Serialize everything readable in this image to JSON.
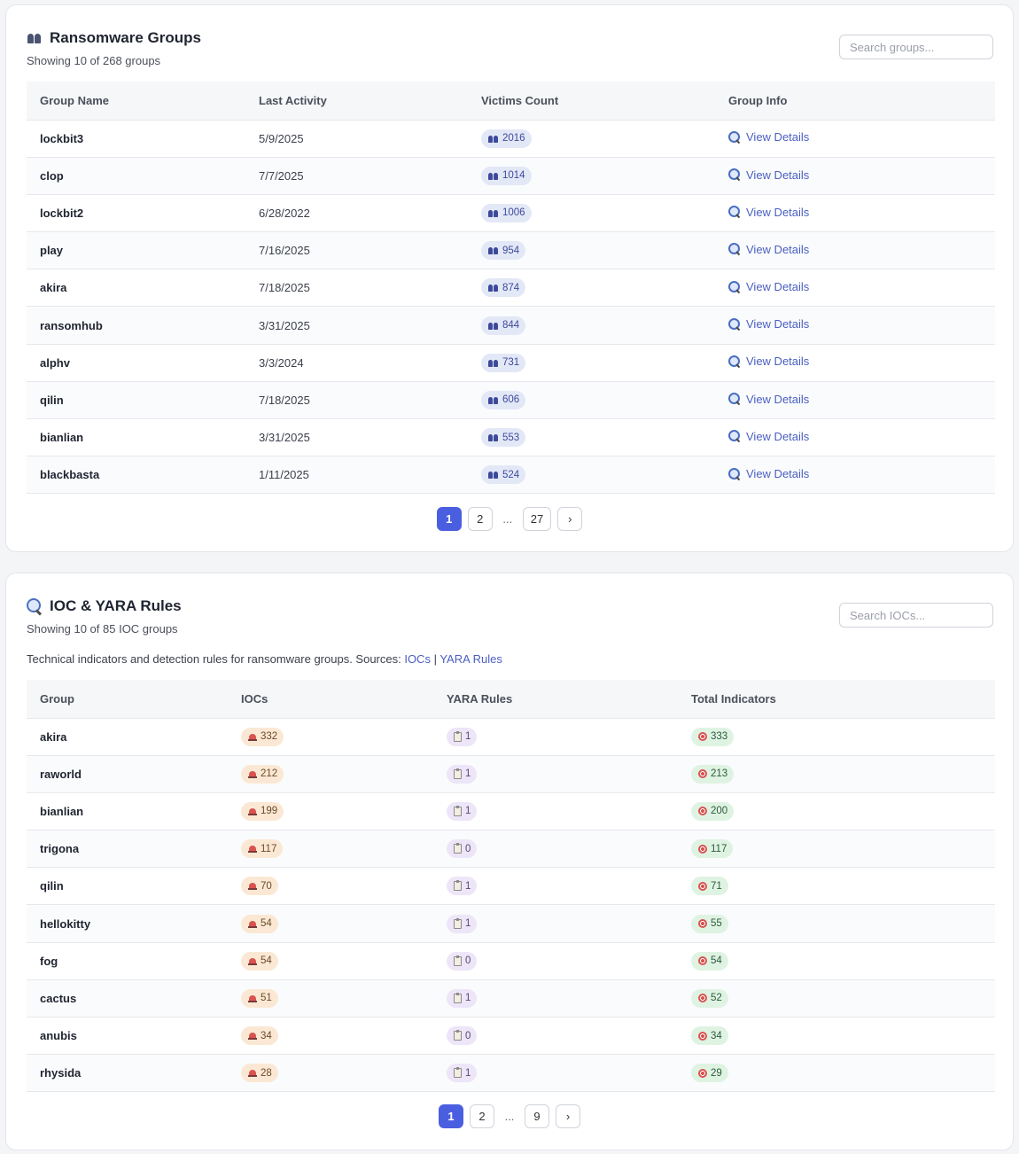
{
  "groups_panel": {
    "title": "Ransomware Groups",
    "subtitle": "Showing 10 of 268 groups",
    "search_placeholder": "Search groups...",
    "columns": [
      "Group Name",
      "Last Activity",
      "Victims Count",
      "Group Info"
    ],
    "link_label": "View Details",
    "rows": [
      {
        "name": "lockbit3",
        "last_activity": "5/9/2025",
        "victims": "2016"
      },
      {
        "name": "clop",
        "last_activity": "7/7/2025",
        "victims": "1014"
      },
      {
        "name": "lockbit2",
        "last_activity": "6/28/2022",
        "victims": "1006"
      },
      {
        "name": "play",
        "last_activity": "7/16/2025",
        "victims": "954"
      },
      {
        "name": "akira",
        "last_activity": "7/18/2025",
        "victims": "874"
      },
      {
        "name": "ransomhub",
        "last_activity": "3/31/2025",
        "victims": "844"
      },
      {
        "name": "alphv",
        "last_activity": "3/3/2024",
        "victims": "731"
      },
      {
        "name": "qilin",
        "last_activity": "7/18/2025",
        "victims": "606"
      },
      {
        "name": "bianlian",
        "last_activity": "3/31/2025",
        "victims": "553"
      },
      {
        "name": "blackbasta",
        "last_activity": "1/11/2025",
        "victims": "524"
      }
    ],
    "pagination": [
      "1",
      "2",
      "...",
      "27",
      "›"
    ]
  },
  "ioc_panel": {
    "title": "IOC & YARA Rules",
    "subtitle": "Showing 10 of 85 IOC groups",
    "search_placeholder": "Search IOCs...",
    "description": "Technical indicators and detection rules for ransomware groups. Sources: ",
    "source_link_1": "IOCs",
    "source_sep": " | ",
    "source_link_2": "YARA Rules",
    "columns": [
      "Group",
      "IOCs",
      "YARA Rules",
      "Total Indicators"
    ],
    "rows": [
      {
        "name": "akira",
        "iocs": "332",
        "yara": "1",
        "total": "333"
      },
      {
        "name": "raworld",
        "iocs": "212",
        "yara": "1",
        "total": "213"
      },
      {
        "name": "bianlian",
        "iocs": "199",
        "yara": "1",
        "total": "200"
      },
      {
        "name": "trigona",
        "iocs": "117",
        "yara": "0",
        "total": "117"
      },
      {
        "name": "qilin",
        "iocs": "70",
        "yara": "1",
        "total": "71"
      },
      {
        "name": "hellokitty",
        "iocs": "54",
        "yara": "1",
        "total": "55"
      },
      {
        "name": "fog",
        "iocs": "54",
        "yara": "0",
        "total": "54"
      },
      {
        "name": "cactus",
        "iocs": "51",
        "yara": "1",
        "total": "52"
      },
      {
        "name": "anubis",
        "iocs": "34",
        "yara": "0",
        "total": "34"
      },
      {
        "name": "rhysida",
        "iocs": "28",
        "yara": "1",
        "total": "29"
      }
    ],
    "pagination": [
      "1",
      "2",
      "...",
      "9",
      "›"
    ]
  },
  "icons": {
    "groups_title": "people-icon",
    "ioc_title": "magnifier-icon",
    "victims": "people-icon",
    "view": "magnifier-icon",
    "iocs": "siren-icon",
    "yara": "clipboard-icon",
    "total": "target-icon"
  },
  "colors": {
    "accent": "#4a5fe0",
    "link": "#4a5fc1",
    "victims_pill": "#e3e8f7",
    "ioc_pill": "#fbe8d4",
    "yara_pill": "#ede5f8",
    "total_pill": "#dff3e3"
  }
}
